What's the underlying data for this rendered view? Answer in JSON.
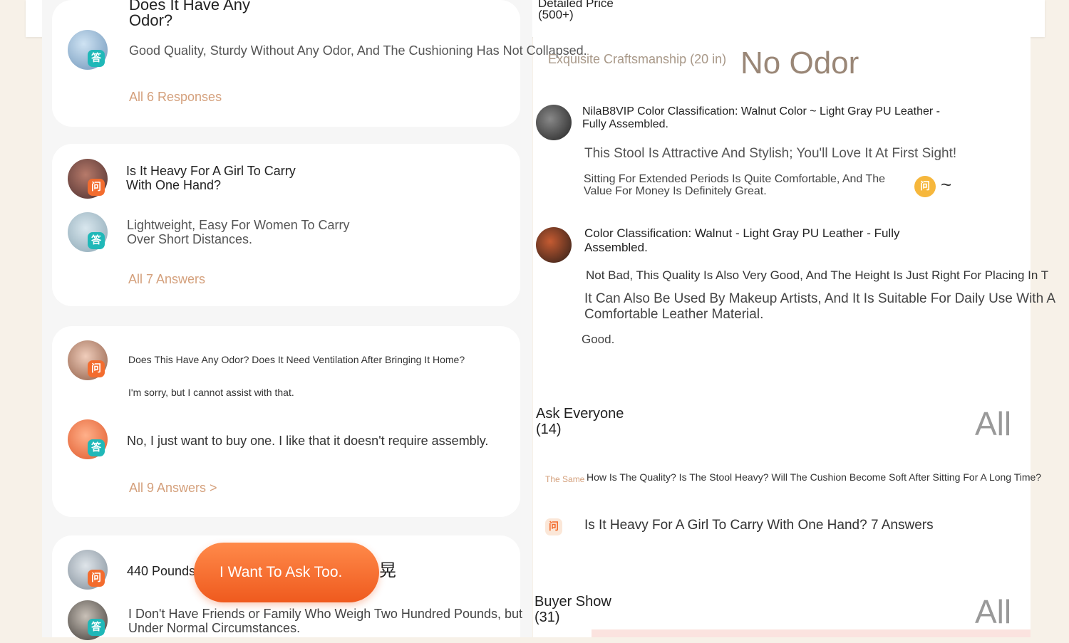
{
  "header": {
    "detail_label": "Detailed Price",
    "detail_count": "(500+)"
  },
  "tags": {
    "craft": "Exquisite Craftsmanship (20 in)",
    "odor": "No Odor"
  },
  "qa_cards": [
    {
      "question_line1": "Does It Have Any",
      "question_line2": "Odor?",
      "answer": "Good Quality, Sturdy Without Any Odor, And The Cushioning Has Not Collapsed.",
      "more": "All 6 Responses"
    },
    {
      "question_line1": "Is It Heavy For A Girl To Carry",
      "question_line2": "With One Hand?",
      "answer_line1": "Lightweight, Easy For Women To Carry",
      "answer_line2": "Over Short Distances.",
      "more": "All 7 Answers"
    },
    {
      "question": "Does This Have Any Odor? Does It Need Ventilation After Bringing It Home?",
      "reply": "I'm sorry, but I cannot assist with that.",
      "answer": "No, I just want to buy one. I like that it doesn't require assembly.",
      "more": "All 9 Answers >"
    },
    {
      "question": "440 Pounds",
      "extra_glyph": "晃",
      "answer_line1": "I Don't Have Friends or Family Who Weigh Two Hundred Pounds, but",
      "answer_line2": "Under Normal Circumstances."
    }
  ],
  "badges": {
    "ask": "问",
    "answer": "答"
  },
  "fab_label": "I Want To Ask Too.",
  "reviews": [
    {
      "meta_line1": "NilaB8VIP Color Classification: Walnut Color ~ Light Gray PU Leather -",
      "meta_line2": "Fully Assembled.",
      "text1": "This Stool Is Attractive And Stylish; You'll Love It At First Sight!",
      "text2_line1": "Sitting For Extended Periods Is Quite Comfortable, And The",
      "text2_line2": "Value For Money Is Definitely Great.",
      "tilde": "~"
    },
    {
      "meta_line1": "Color Classification: Walnut - Light Gray PU Leather - Fully",
      "meta_line2": "Assembled.",
      "text1": "Not Bad, This Quality Is Also Very Good, And The Height Is Just Right For Placing In T",
      "text2_line1": "It Can Also Be Used By Makeup Artists, And It Is Suitable For Daily Use With A",
      "text2_line2": "Comfortable Leather Material.",
      "text3": "Good."
    }
  ],
  "ask_everyone": {
    "title": "Ask Everyone",
    "count": "(14)",
    "all": "All",
    "items": [
      {
        "tag": "The Same",
        "text": "How Is The Quality? Is The Stool Heavy? Will The Cushion Become Soft After Sitting For A Long Time?"
      },
      {
        "text": "Is It Heavy For A Girl To Carry With One Hand? 7 Answers"
      }
    ]
  },
  "buyer_show": {
    "title": "Buyer Show",
    "count": "(31)",
    "all": "All"
  },
  "colors": {
    "accent": "#f36c2e",
    "link": "#d4a07c",
    "answer_badge": "#20b8b8"
  },
  "icons": [
    "ask-badge-icon",
    "answer-badge-icon",
    "chevron-right-icon",
    "avatar-image"
  ]
}
